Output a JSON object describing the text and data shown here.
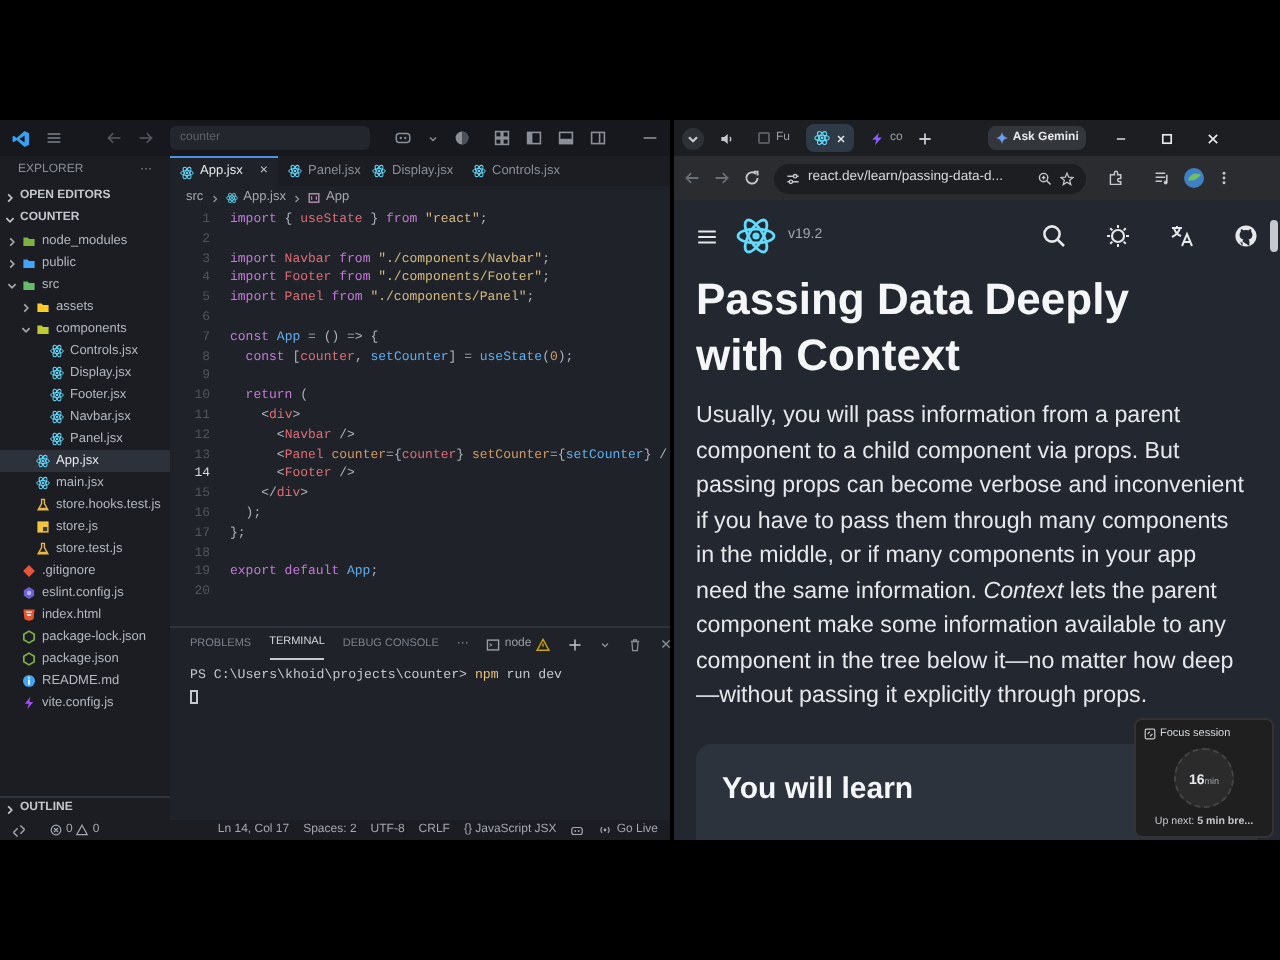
{
  "vscode": {
    "title_bar": {
      "search": "counter"
    },
    "explorer": {
      "title": "EXPLORER",
      "more": "···",
      "open_editors": {
        "label": "OPEN EDITORS",
        "expanded": false
      },
      "project": {
        "label": "COUNTER",
        "expanded": true,
        "children": [
          {
            "name": "node_modules",
            "kind": "folder",
            "color": "#7cb342",
            "expanded": false,
            "selected": false
          },
          {
            "name": "public",
            "kind": "folder",
            "color": "#42a5f5",
            "expanded": false,
            "selected": false
          },
          {
            "name": "src",
            "kind": "folder",
            "color": "#66bb6a",
            "expanded": true,
            "selected": false,
            "children": [
              {
                "name": "assets",
                "kind": "folder",
                "color": "#ffca28",
                "expanded": false,
                "selected": false
              },
              {
                "name": "components",
                "kind": "folder",
                "color": "#c0ca33",
                "expanded": true,
                "selected": false,
                "children": [
                  {
                    "name": "Controls.jsx",
                    "kind": "react",
                    "selected": false
                  },
                  {
                    "name": "Display.jsx",
                    "kind": "react",
                    "selected": false
                  },
                  {
                    "name": "Footer.jsx",
                    "kind": "react",
                    "selected": false
                  },
                  {
                    "name": "Navbar.jsx",
                    "kind": "react",
                    "selected": false
                  },
                  {
                    "name": "Panel.jsx",
                    "kind": "react",
                    "selected": false
                  }
                ]
              },
              {
                "name": "App.jsx",
                "kind": "react",
                "selected": true
              },
              {
                "name": "main.jsx",
                "kind": "react",
                "selected": false
              },
              {
                "name": "store.hooks.test.js",
                "kind": "test",
                "selected": false
              },
              {
                "name": "store.js",
                "kind": "js",
                "selected": false
              },
              {
                "name": "store.test.js",
                "kind": "test",
                "selected": false
              }
            ]
          },
          {
            "name": ".gitignore",
            "kind": "git",
            "selected": false
          },
          {
            "name": "eslint.config.js",
            "kind": "eslint",
            "selected": false
          },
          {
            "name": "index.html",
            "kind": "html",
            "selected": false
          },
          {
            "name": "package-lock.json",
            "kind": "npm",
            "selected": false
          },
          {
            "name": "package.json",
            "kind": "npm",
            "selected": false
          },
          {
            "name": "README.md",
            "kind": "info",
            "selected": false
          },
          {
            "name": "vite.config.js",
            "kind": "vite",
            "selected": false
          }
        ]
      },
      "outline": {
        "label": "OUTLINE",
        "expanded": false
      }
    },
    "tabs": [
      {
        "label": "App.jsx",
        "selected": true,
        "close": "×"
      },
      {
        "label": "Panel.jsx",
        "selected": false
      },
      {
        "label": "Display.jsx",
        "selected": false
      },
      {
        "label": "Controls.jsx",
        "selected": false
      }
    ],
    "breadcrumb": [
      "src",
      "App.jsx",
      "App"
    ],
    "code": [
      {
        "number": "1",
        "current": false,
        "tokens": [
          {
            "kind": "kw",
            "text": "import"
          },
          {
            "kind": "punct",
            "text": " { "
          },
          {
            "kind": "var",
            "text": "useState"
          },
          {
            "kind": "punct",
            "text": " } "
          },
          {
            "kind": "kw",
            "text": "from"
          },
          {
            "kind": "str",
            "text": " \"react\""
          },
          {
            "kind": "punct",
            "text": ";"
          }
        ]
      },
      {
        "number": "2",
        "current": false
      },
      {
        "number": "3",
        "current": false,
        "tokens": [
          {
            "kind": "kw",
            "text": "import"
          },
          {
            "kind": "var",
            "text": " Navbar "
          },
          {
            "kind": "kw",
            "text": "from"
          },
          {
            "kind": "str",
            "text": " \"./components/Navbar\""
          },
          {
            "kind": "punct",
            "text": ";"
          }
        ]
      },
      {
        "number": "4",
        "current": false,
        "tokens": [
          {
            "kind": "kw",
            "text": "import"
          },
          {
            "kind": "var",
            "text": " Footer "
          },
          {
            "kind": "kw",
            "text": "from"
          },
          {
            "kind": "str",
            "text": " \"./components/Footer\""
          },
          {
            "kind": "punct",
            "text": ";"
          }
        ]
      },
      {
        "number": "5",
        "current": false,
        "tokens": [
          {
            "kind": "kw",
            "text": "import"
          },
          {
            "kind": "var",
            "text": " Panel "
          },
          {
            "kind": "kw",
            "text": "from"
          },
          {
            "kind": "str",
            "text": " \"./components/Panel\""
          },
          {
            "kind": "punct",
            "text": ";"
          }
        ]
      },
      {
        "number": "6",
        "current": false
      },
      {
        "number": "7",
        "current": false,
        "tokens": [
          {
            "kind": "kw",
            "text": "const"
          },
          {
            "kind": "fn",
            "text": " App"
          },
          {
            "kind": "punct",
            "text": " = () => {"
          }
        ]
      },
      {
        "number": "8",
        "current": false,
        "tokens": [
          {
            "kind": "kw",
            "text": "  const"
          },
          {
            "kind": "punct",
            "text": " ["
          },
          {
            "kind": "var",
            "text": "counter"
          },
          {
            "kind": "punct",
            "text": ", "
          },
          {
            "kind": "fn",
            "text": "setCounter"
          },
          {
            "kind": "punct",
            "text": "] = "
          },
          {
            "kind": "fn",
            "text": "useState"
          },
          {
            "kind": "punct",
            "text": "("
          },
          {
            "kind": "num",
            "text": "0"
          },
          {
            "kind": "punct",
            "text": ");"
          }
        ]
      },
      {
        "number": "9",
        "current": false
      },
      {
        "number": "10",
        "current": false,
        "tokens": [
          {
            "kind": "kw",
            "text": "  return"
          },
          {
            "kind": "punct",
            "text": " ("
          }
        ]
      },
      {
        "number": "11",
        "current": false,
        "tokens": [
          {
            "kind": "punct",
            "text": "    <"
          },
          {
            "kind": "tag",
            "text": "div"
          },
          {
            "kind": "punct",
            "text": ">"
          }
        ]
      },
      {
        "number": "12",
        "current": false,
        "tokens": [
          {
            "kind": "punct",
            "text": "      <"
          },
          {
            "kind": "tag",
            "text": "Navbar"
          },
          {
            "kind": "punct",
            "text": " />"
          }
        ]
      },
      {
        "number": "13",
        "current": false,
        "tokens": [
          {
            "kind": "punct",
            "text": "      <"
          },
          {
            "kind": "tag",
            "text": "Panel"
          },
          {
            "kind": "attr",
            "text": " counter"
          },
          {
            "kind": "punct",
            "text": "={"
          },
          {
            "kind": "var",
            "text": "counter"
          },
          {
            "kind": "punct",
            "text": "}"
          },
          {
            "kind": "attr",
            "text": " setCounter"
          },
          {
            "kind": "punct",
            "text": "={"
          },
          {
            "kind": "fn",
            "text": "setCounter"
          },
          {
            "kind": "punct",
            "text": "} /"
          }
        ]
      },
      {
        "number": "14",
        "current": true,
        "tokens": [
          {
            "kind": "punct",
            "text": "      <"
          },
          {
            "kind": "tag",
            "text": "Footer"
          },
          {
            "kind": "punct",
            "text": " />"
          }
        ]
      },
      {
        "number": "15",
        "current": false,
        "tokens": [
          {
            "kind": "punct",
            "text": "    </"
          },
          {
            "kind": "tag",
            "text": "div"
          },
          {
            "kind": "punct",
            "text": ">"
          }
        ]
      },
      {
        "number": "16",
        "current": false,
        "tokens": [
          {
            "kind": "punct",
            "text": "  );"
          }
        ]
      },
      {
        "number": "17",
        "current": false,
        "tokens": [
          {
            "kind": "punct",
            "text": "};"
          }
        ]
      },
      {
        "number": "18",
        "current": false
      },
      {
        "number": "19",
        "current": false,
        "tokens": [
          {
            "kind": "kw",
            "text": "export default"
          },
          {
            "kind": "fn",
            "text": " App"
          },
          {
            "kind": "punct",
            "text": ";"
          }
        ]
      },
      {
        "number": "20",
        "current": false
      }
    ],
    "panel": {
      "tabs": [
        {
          "label": "PROBLEMS",
          "selected": false
        },
        {
          "label": "TERMINAL",
          "selected": true
        },
        {
          "label": "DEBUG CONSOLE",
          "selected": false
        }
      ],
      "more": "···",
      "terminal_name": "node",
      "prompt": "PS C:\\Users\\khoid\\projects\\counter> ",
      "command": "npm",
      "args": " run dev"
    },
    "status_bar": {
      "errors": "0",
      "warnings": "0",
      "items": [
        "Ln 14, Col 17",
        "Spaces: 2",
        "UTF-8",
        "CRLF",
        "{} JavaScript JSX"
      ],
      "live": "Go Live"
    }
  },
  "chrome": {
    "tabs": [
      {
        "kind": "audio",
        "selected": false
      },
      {
        "kind": "blank",
        "label": "Fu",
        "selected": false
      },
      {
        "kind": "react",
        "selected": true
      },
      {
        "kind": "bolt",
        "label": "co",
        "selected": false
      }
    ],
    "gemini": "Ask Gemini",
    "url": "react.dev/learn/passing-data-d...",
    "page": {
      "version": "v19.2",
      "title": "Passing Data Deeply with Context",
      "intro": "Usually, you will pass information from a parent component to a child component via props. But passing props can become verbose and inconvenient if you have to pass them through many components in the middle, or if many components in your app need the same information. *Context* lets the parent component make some information available to any component in the tree below it—no matter how deep—without passing it explicitly through props.",
      "card_title": "You will learn"
    },
    "focus": {
      "title": "Focus session",
      "minutes": "16",
      "unit": "min",
      "next": "Up next: **5 min bre...**"
    }
  }
}
